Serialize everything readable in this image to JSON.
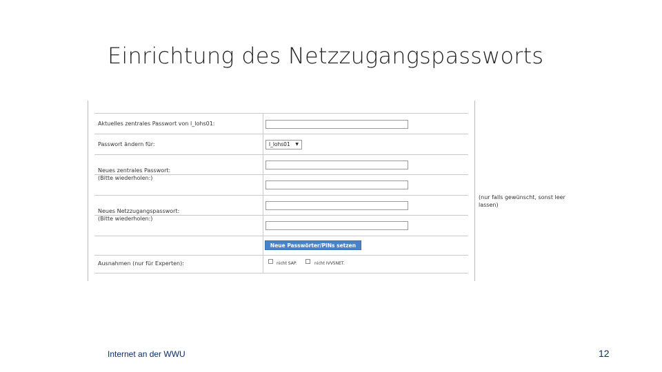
{
  "slide": {
    "title": "Einrichtung des Netzzugangspassworts",
    "footer_left": "Internet an der WWU",
    "page_number": "12"
  },
  "form": {
    "current_password_label": "Aktuelles zentrales Passwort von l_lohs01:",
    "change_for_label": "Passwort ändern für:",
    "change_for_value": "l_lohs01",
    "new_central_label": "Neues zentrales Passwort:",
    "new_central_repeat": "(Bitte wiederholen:)",
    "new_network_label": "Neues Netzzugangspasswort:",
    "new_network_repeat": "(Bitte wiederholen:)",
    "submit_label": "Neue Passwörter/PINs setzen",
    "exceptions_label": "Ausnahmen (nur für Experten):",
    "checkbox_sap": "nicht SAP.",
    "checkbox_ivv": "nicht IVV5NET.",
    "side_note": "(nur falls gewünscht, sonst leer lassen)"
  }
}
